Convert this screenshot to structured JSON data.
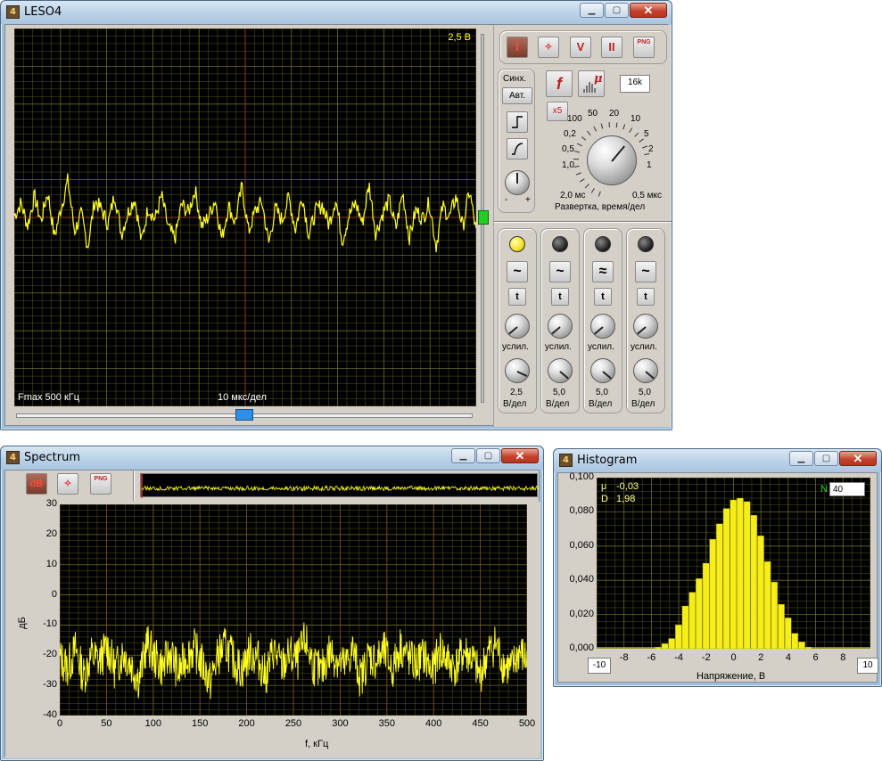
{
  "leso_window": {
    "title": "LESO4",
    "scope": {
      "voltage_label": "2,5 В",
      "fmax_label": "Fmax 500 кГц",
      "time_label": "10 мкс/дел"
    },
    "toolbar": {
      "run_label": "I",
      "cursor_label": "✧",
      "v_label": "V",
      "pause_label": "II",
      "png_label": "PNG"
    },
    "sync": {
      "title": "Синх.",
      "auto_label": "Авт.",
      "minus": "-",
      "plus": "+"
    },
    "timebase": {
      "f_label": "f",
      "mu_label": "μ",
      "points_value": "16k",
      "x5_label": "x5",
      "scale": [
        "100",
        "50",
        "20",
        "10",
        "5",
        "2",
        "1",
        "0,5 мкс",
        "2,0 мс",
        "1,0",
        "0,5",
        "0,2"
      ],
      "caption": "Развертка, время/дел"
    },
    "channels": [
      {
        "led_on": true,
        "wave_label": "~",
        "t_label": "t",
        "gain_label": "услил.",
        "value": "2,5",
        "unit": "В/дел"
      },
      {
        "led_on": false,
        "wave_label": "~",
        "t_label": "t",
        "gain_label": "услил.",
        "value": "5,0",
        "unit": "В/дел"
      },
      {
        "led_on": false,
        "wave_label": "≈",
        "t_label": "t",
        "gain_label": "услил.",
        "value": "5,0",
        "unit": "В/дел"
      },
      {
        "led_on": false,
        "wave_label": "~",
        "t_label": "t",
        "gain_label": "услил.",
        "value": "5,0",
        "unit": "В/дел"
      }
    ]
  },
  "spectrum_window": {
    "title": "Spectrum",
    "toolbar": {
      "db_label": "dB",
      "cursor_label": "✧",
      "png_label": "PNG"
    },
    "ylabel": "дБ",
    "xlabel": "f, кГц",
    "yticks": [
      "30",
      "20",
      "10",
      "0",
      "-10",
      "-20",
      "-30",
      "-40"
    ],
    "xticks": [
      "0",
      "50",
      "100",
      "150",
      "200",
      "250",
      "300",
      "350",
      "400",
      "450",
      "500"
    ]
  },
  "histogram_window": {
    "title": "Histogram",
    "mu_label": "μ",
    "mu_value": "-0,03",
    "d_label": "D",
    "d_value": "1,98",
    "n_label": "N",
    "n_value": "40",
    "min_value": "-10",
    "max_value": "10",
    "xlabel": "Напряжение, В",
    "yticks": [
      "0,100",
      "0,080",
      "0,060",
      "0,040",
      "0,020",
      "0,000"
    ],
    "xticks": [
      "-8",
      "-6",
      "-4",
      "-2",
      "0",
      "2",
      "4",
      "6",
      "8"
    ]
  },
  "colors": {
    "trace": "#ffff22",
    "grid": "#6b6b22",
    "grid_center": "#8b3a2a",
    "title_bar": "#b8d0e6",
    "panel": "#d4d0c8"
  },
  "chart_data": [
    {
      "type": "line",
      "chart": "oscilloscope",
      "x": "0-100 мкс (10 мкс/дел)",
      "ylim": [
        -25,
        25
      ],
      "description_units": "В",
      "series": [
        {
          "values": [
            0.2,
            1.9,
            -1.1,
            2.8,
            -0.5,
            3.4,
            -2.6,
            1.3,
            4.9,
            -1.8,
            0.4,
            -3.9,
            2.2,
            1.1,
            -0.9,
            3.1,
            -2.2,
            0.7,
            2.6,
            -3.3,
            1.4,
            -0.3,
            2.9,
            -1.4,
            -2.8,
            1.8,
            0.6,
            3.7,
            -1.2,
            0.1,
            2.4,
            -2.9,
            1.6,
            -0.7,
            4.1,
            -1.9,
            0.9,
            2.1,
            -3.5,
            1.2,
            -0.4,
            2.7,
            -1.6,
            3.0,
            -2.4,
            0.8,
            1.7,
            -1.0,
            2.5,
            -3.1,
            0.3,
            1.9,
            -0.8,
            4.4,
            -2.1,
            0.5,
            2.3,
            -1.5,
            3.3,
            -2.7,
            1.0,
            -0.2,
            2.0,
            -3.8,
            1.5,
            0.0,
            2.8,
            -1.3,
            3.6,
            -2.0
          ]
        }
      ]
    },
    {
      "type": "line",
      "chart": "spectrum",
      "x_range": [
        0,
        500
      ],
      "xlabel": "f, кГц",
      "ylabel": "дБ",
      "ylim": [
        -40,
        30
      ],
      "series": [
        {
          "values": [
            -21,
            -24,
            -18,
            -27,
            -20,
            -22,
            -17,
            -25,
            -19,
            -23,
            -28,
            -16,
            -21,
            -24,
            -19,
            -26,
            -20,
            -18,
            -23,
            -29,
            -20,
            -17,
            -22,
            -25,
            -19,
            -21,
            -27,
            -18,
            -24,
            -20,
            -22,
            -15,
            -23,
            -26,
            -19,
            -21,
            -24,
            -18,
            -28,
            -20,
            -22,
            -19,
            -25,
            -17,
            -21,
            -23,
            -20,
            -26,
            -18,
            -22,
            -24,
            -19,
            -21,
            -27,
            -20,
            -16,
            -23,
            -25,
            -19,
            -22
          ]
        }
      ]
    },
    {
      "type": "bar",
      "chart": "histogram",
      "xlabel": "Напряжение, В",
      "xlim": [
        -10,
        10
      ],
      "ylim": [
        0,
        0.1
      ],
      "categories": [
        -5.5,
        -5,
        -4.5,
        -4,
        -3.5,
        -3,
        -2.5,
        -2,
        -1.5,
        -1,
        -0.5,
        0,
        0.5,
        1,
        1.5,
        2,
        2.5,
        3,
        3.5,
        4,
        4.5,
        5,
        5.5
      ],
      "values": [
        0.001,
        0.003,
        0.006,
        0.014,
        0.025,
        0.033,
        0.041,
        0.05,
        0.064,
        0.073,
        0.082,
        0.087,
        0.088,
        0.086,
        0.078,
        0.066,
        0.051,
        0.039,
        0.026,
        0.018,
        0.009,
        0.004,
        0.001
      ]
    }
  ]
}
